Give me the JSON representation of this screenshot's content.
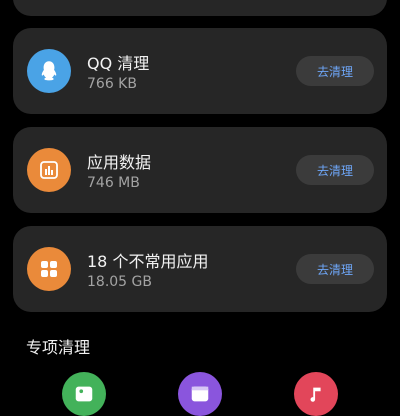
{
  "items": [
    {
      "title": "QQ 清理",
      "size": "766 KB",
      "action": "去清理",
      "icon": "qq-penguin-icon",
      "color": "#4aa3e6"
    },
    {
      "title": "应用数据",
      "size": "746 MB",
      "action": "去清理",
      "icon": "bar-chart-icon",
      "color": "#ea8a3a"
    },
    {
      "title": "18 个不常用应用",
      "size": "18.05 GB",
      "action": "去清理",
      "icon": "app-grid-icon",
      "color": "#ea8a3a"
    }
  ],
  "section": {
    "title": "专项清理"
  },
  "special": [
    {
      "icon": "photo-icon",
      "color": "#43b25a"
    },
    {
      "icon": "video-icon",
      "color": "#8a55dd"
    },
    {
      "icon": "music-icon",
      "color": "#e2465a"
    }
  ]
}
